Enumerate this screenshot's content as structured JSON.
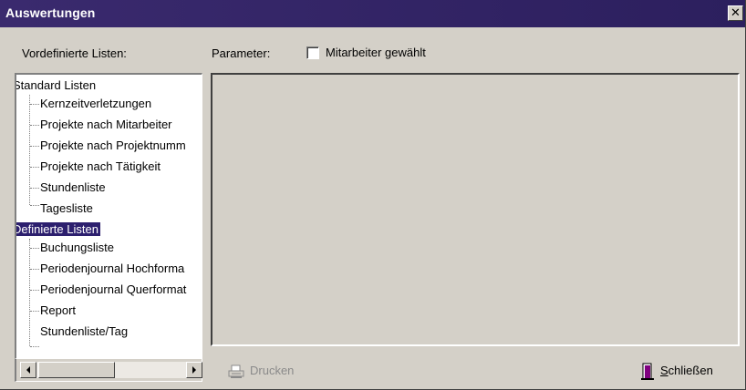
{
  "window": {
    "title": "Auswertungen",
    "close_glyph": "✕"
  },
  "labels": {
    "predefined_lists": "Vordefinierte Listen:",
    "parameter": "Parameter:",
    "checkbox_label": "Mitarbeiter gewählt"
  },
  "checkbox": {
    "checked": false
  },
  "tree": {
    "groups": [
      {
        "label": "Standard Listen",
        "selected": false,
        "items": [
          "Kernzeitverletzungen",
          "Projekte nach Mitarbeiter",
          "Projekte nach Projektnumm",
          "Projekte nach Tätigkeit",
          "Stundenliste",
          "Tagesliste"
        ]
      },
      {
        "label": "Definierte Listen",
        "selected": true,
        "items": [
          "Buchungsliste",
          "Periodenjournal Hochforma",
          "Periodenjournal Querformat",
          "Report",
          "Stundenliste/Tag"
        ]
      }
    ]
  },
  "buttons": {
    "print_label": "Drucken",
    "print_icon": "printer-icon",
    "print_enabled": false,
    "close_label_accel": "S",
    "close_label_rest": "chließen",
    "close_icon": "door-exit-icon"
  },
  "colors": {
    "titlebar": "#2c1f5e",
    "selection": "#2c1f6e",
    "dialog_bg": "#d4d0c8"
  }
}
